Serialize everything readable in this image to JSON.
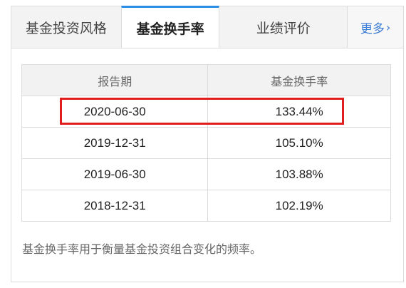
{
  "tabs": [
    {
      "label": "基金投资风格"
    },
    {
      "label": "基金换手率",
      "active": true
    },
    {
      "label": "业绩评价"
    }
  ],
  "more": {
    "label": "更多",
    "arrow": "›"
  },
  "table": {
    "headers": [
      "报告期",
      "基金换手率"
    ],
    "rows": [
      [
        "2020-06-30",
        "133.44%"
      ],
      [
        "2019-12-31",
        "105.10%"
      ],
      [
        "2019-06-30",
        "103.88%"
      ],
      [
        "2018-12-31",
        "102.19%"
      ]
    ]
  },
  "note": "基金换手率用于衡量基金投资组合变化的频率。",
  "colors": {
    "active_tab_border": "#2d8de4",
    "highlight_box": "#e01e1e",
    "more_link": "#3a7bd5"
  }
}
